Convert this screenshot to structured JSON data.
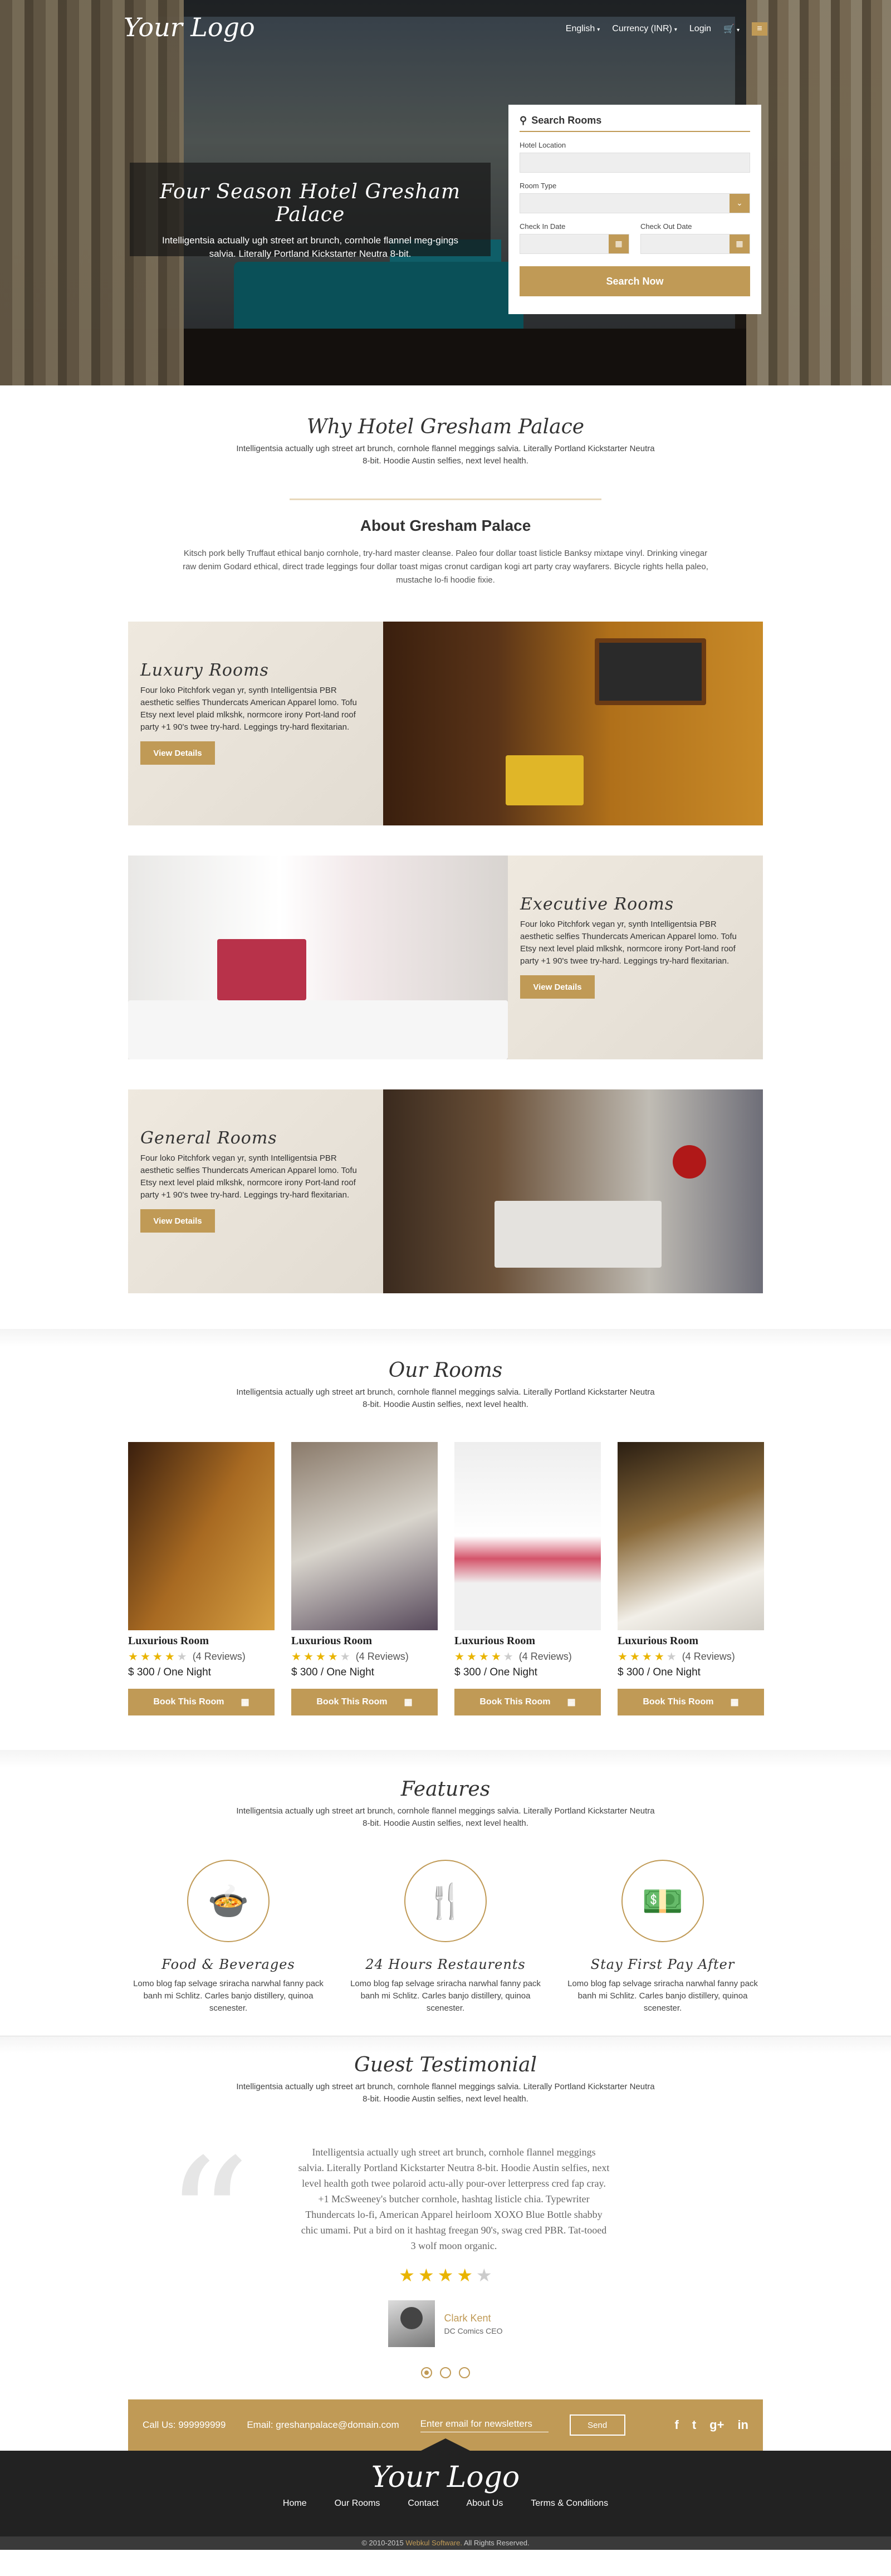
{
  "header": {
    "logo": "Your Logo",
    "lang": "English",
    "currency": "Currency (INR)",
    "login": "Login"
  },
  "hero": {
    "title": "Four Season Hotel Gresham Palace",
    "text": "Intelligentsia actually ugh street art brunch, cornhole flannel meg-gings salvia. Literally Portland Kickstarter Neutra 8-bit."
  },
  "search": {
    "title": "Search Rooms",
    "location_label": "Hotel Location",
    "room_type_label": "Room Type",
    "checkin_label": "Check In Date",
    "checkout_label": "Check Out Date",
    "button": "Search Now"
  },
  "why": {
    "title": "Why Hotel Gresham Palace",
    "text": "Intelligentsia actually ugh street art brunch, cornhole flannel meggings salvia. Literally Portland Kickstarter Neutra 8-bit. Hoodie Austin selfies, next level health."
  },
  "about": {
    "title": "About Gresham Palace",
    "text": "Kitsch pork belly Truffaut ethical banjo cornhole, try-hard master cleanse. Paleo four dollar toast listicle Banksy mixtape vinyl. Drinking vinegar raw denim Godard ethical, direct trade leggings four dollar toast migas cronut cardigan kogi art party cray wayfarers. Bicycle rights hella paleo, mustache lo-fi hoodie fixie."
  },
  "features_rooms": [
    {
      "title": "Luxury Rooms",
      "text": "Four loko Pitchfork vegan yr, synth Intelligentsia PBR aesthetic selfies Thundercats American Apparel lomo. Tofu Etsy next level plaid mlkshk, normcore irony Port-land roof party +1 90's twee try-hard. Leggings try-hard flexitarian.",
      "button": "View Details"
    },
    {
      "title": "Executive Rooms",
      "text": "Four loko Pitchfork vegan yr, synth Intelligentsia PBR aesthetic selfies Thundercats American Apparel lomo. Tofu Etsy next level plaid mlkshk, normcore irony Port-land roof party +1 90's twee try-hard. Leggings try-hard flexitarian.",
      "button": "View Details"
    },
    {
      "title": "General Rooms",
      "text": "Four loko Pitchfork vegan yr, synth Intelligentsia PBR aesthetic selfies Thundercats American Apparel lomo. Tofu Etsy next level plaid mlkshk, normcore irony Port-land roof party +1 90's twee try-hard. Leggings try-hard flexitarian.",
      "button": "View Details"
    }
  ],
  "our_rooms": {
    "title": "Our Rooms",
    "text": "Intelligentsia actually ugh street art brunch, cornhole flannel meggings salvia. Literally Portland Kickstarter Neutra 8-bit. Hoodie Austin selfies, next level health.",
    "cards": [
      {
        "name": "Luxurious Room",
        "reviews": "(4 Reviews)",
        "rating": 4,
        "price": "$ 300 / One Night",
        "button": "Book This Room"
      },
      {
        "name": "Luxurious Room",
        "reviews": "(4 Reviews)",
        "rating": 4,
        "price": "$ 300 / One Night",
        "button": "Book This Room"
      },
      {
        "name": "Luxurious Room",
        "reviews": "(4 Reviews)",
        "rating": 4,
        "price": "$ 300 / One Night",
        "button": "Book This Room"
      },
      {
        "name": "Luxurious Room",
        "reviews": "(4 Reviews)",
        "rating": 4,
        "price": "$ 300 / One Night",
        "button": "Book This Room"
      }
    ]
  },
  "features": {
    "title": "Features",
    "text": "Intelligentsia actually ugh street art brunch, cornhole flannel meggings salvia. Literally Portland Kickstarter Neutra 8-bit. Hoodie Austin selfies, next level health.",
    "items": [
      {
        "title": "Food & Beverages",
        "icon": "food-tray-icon",
        "text": "Lomo blog fap selvage sriracha narwhal fanny pack banh mi Schlitz. Carles banjo distillery, quinoa scenester."
      },
      {
        "title": "24 Hours Restaurents",
        "icon": "fork-knife-icon",
        "text": "Lomo blog fap selvage sriracha narwhal fanny pack banh mi Schlitz. Carles banjo distillery, quinoa scenester."
      },
      {
        "title": "Stay First Pay After",
        "icon": "money-icon",
        "text": "Lomo blog fap selvage sriracha narwhal fanny pack banh mi Schlitz. Carles banjo distillery, quinoa scenester."
      }
    ]
  },
  "testimonial": {
    "title": "Guest Testimonial",
    "text": "Intelligentsia actually ugh street art brunch, cornhole flannel meggings salvia. Literally Portland Kickstarter Neutra 8-bit. Hoodie Austin selfies, next level health.",
    "quote": "Intelligentsia actually ugh street art brunch, cornhole flannel meggings salvia. Literally Portland Kickstarter Neutra 8-bit. Hoodie Austin selfies, next level health goth twee polaroid actu-ally pour-over letterpress cred fap cray. +1 McSweeney's butcher cornhole, hashtag listicle chia. Typewriter Thundercats lo-fi, American Apparel heirloom XOXO Blue Bottle shabby chic umami. Put a bird on it hashtag freegan 90's, swag cred PBR. Tat-tooed 3 wolf moon organic.",
    "rating": 4,
    "author": "Clark Kent",
    "role": "DC Comics CEO"
  },
  "contact": {
    "call": "Call Us: 999999999",
    "email": "Email: greshanpalace@domain.com",
    "newsletter_placeholder": "Enter email for newsletters",
    "send": "Send"
  },
  "footer": {
    "logo": "Your Logo",
    "nav": [
      "Home",
      "Our Rooms",
      "Contact",
      "About Us",
      "Terms & Conditions"
    ],
    "copy_pre": "© 2010-2015",
    "copy_brand": "Webkul Software.",
    "copy_post": "All Rights Reserved."
  },
  "colors": {
    "accent": "#c09a56",
    "star": "#e9b400",
    "footer": "#222222"
  }
}
